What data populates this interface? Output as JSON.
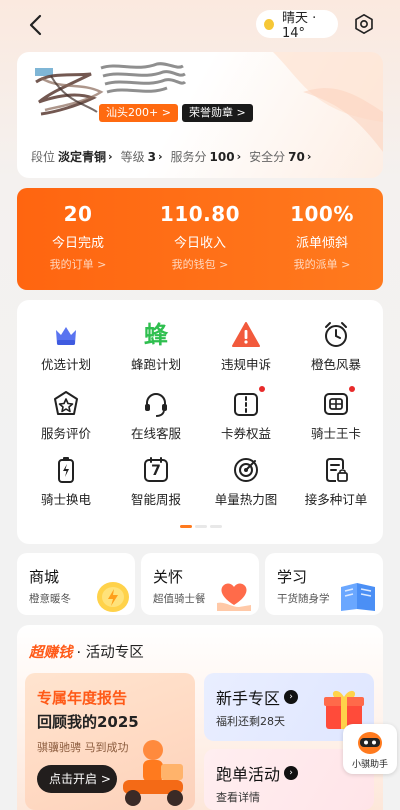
{
  "weather": {
    "text": "晴天 · 14°",
    "icon": "sun-icon"
  },
  "profile": {
    "area_badge": "汕头200+ >",
    "honor_badge": "荣誉勋章 >",
    "stats": [
      {
        "label": "段位",
        "value": "淡定青铜"
      },
      {
        "label": "等级",
        "value": "3"
      },
      {
        "label": "服务分",
        "value": "100"
      },
      {
        "label": "安全分",
        "value": "70"
      }
    ]
  },
  "summary": [
    {
      "value": "20",
      "title": "今日完成",
      "link": "我的订单 >"
    },
    {
      "value": "110.80",
      "title": "今日收入",
      "link": "我的钱包 >"
    },
    {
      "value": "100%",
      "title": "派单倾斜",
      "link": "我的派单 >"
    }
  ],
  "tools": [
    {
      "label": "优选计划",
      "icon": "crown-icon"
    },
    {
      "label": "蜂跑计划",
      "icon": "bee-logo-icon",
      "glyph": "蜂"
    },
    {
      "label": "违规申诉",
      "icon": "warning-icon"
    },
    {
      "label": "橙色风暴",
      "icon": "alarm-clock-icon"
    },
    {
      "label": "服务评价",
      "icon": "star-badge-icon"
    },
    {
      "label": "在线客服",
      "icon": "headset-icon"
    },
    {
      "label": "卡券权益",
      "icon": "coupon-icon"
    },
    {
      "label": "骑士王卡",
      "icon": "sim-card-icon"
    },
    {
      "label": "骑士换电",
      "icon": "battery-icon"
    },
    {
      "label": "智能周报",
      "icon": "calendar-icon",
      "glyph": "7"
    },
    {
      "label": "单量热力图",
      "icon": "target-icon"
    },
    {
      "label": "接多种订单",
      "icon": "order-doc-icon"
    }
  ],
  "colors": {
    "accent": "#ff6a10",
    "reddot": "#e82b2b"
  },
  "shortcuts": [
    {
      "title": "商城",
      "sub": "橙意暖冬"
    },
    {
      "title": "关怀",
      "sub": "超值骑士餐"
    },
    {
      "title": "学习",
      "sub": "干货随身学"
    }
  ],
  "promo": {
    "hot": "超赚钱",
    "title": "· 活动专区",
    "report": {
      "line1": "专属年度报告",
      "line2": "回顾我的2025",
      "line3": "骐骥驰骋 马到成功",
      "button": "点击开启 >"
    },
    "newbie": {
      "title": "新手专区",
      "sub": "福利还剩28天"
    },
    "run": {
      "title": "跑单活动",
      "sub": "查看详情"
    }
  },
  "helper": {
    "label": "小骐助手"
  }
}
